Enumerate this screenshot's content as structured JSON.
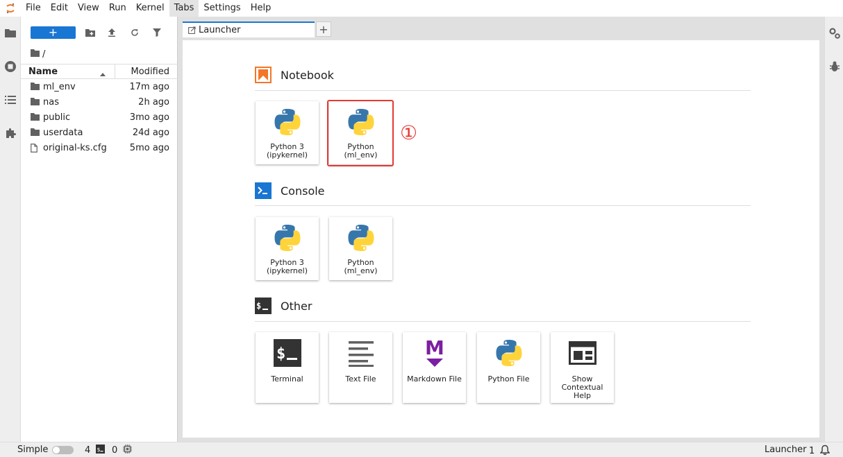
{
  "menu": {
    "items": [
      "File",
      "Edit",
      "View",
      "Run",
      "Kernel",
      "Tabs",
      "Settings",
      "Help"
    ]
  },
  "filebrowser": {
    "new_label": "+",
    "breadcrumb": "/",
    "col_name": "Name",
    "col_modified": "Modified",
    "files": [
      {
        "name": "ml_env",
        "modified": "17m ago",
        "type": "folder"
      },
      {
        "name": "nas",
        "modified": "2h ago",
        "type": "folder"
      },
      {
        "name": "public",
        "modified": "3mo ago",
        "type": "folder"
      },
      {
        "name": "userdata",
        "modified": "24d ago",
        "type": "folder"
      },
      {
        "name": "original-ks.cfg",
        "modified": "5mo ago",
        "type": "file"
      }
    ]
  },
  "tabs": {
    "active_label": "Launcher",
    "add_label": "+"
  },
  "launcher": {
    "notebook": {
      "title": "Notebook",
      "cards": [
        "Python 3\n(ipykernel)",
        "Python\n(ml_env)"
      ]
    },
    "console": {
      "title": "Console",
      "cards": [
        "Python 3\n(ipykernel)",
        "Python\n(ml_env)"
      ]
    },
    "other": {
      "title": "Other",
      "cards": [
        "Terminal",
        "Text File",
        "Markdown File",
        "Python File",
        "Show\nContextual\nHelp"
      ]
    },
    "step_marker": "①"
  },
  "statusbar": {
    "mode": "Simple",
    "terminals": "4",
    "kernels": "0",
    "current": "Launcher",
    "notifications": "1"
  },
  "colors": {
    "accent": "#1976d2",
    "notebook_orange": "#f37726",
    "highlight_red": "#e53935",
    "markdown_purple": "#7b1fa2"
  }
}
